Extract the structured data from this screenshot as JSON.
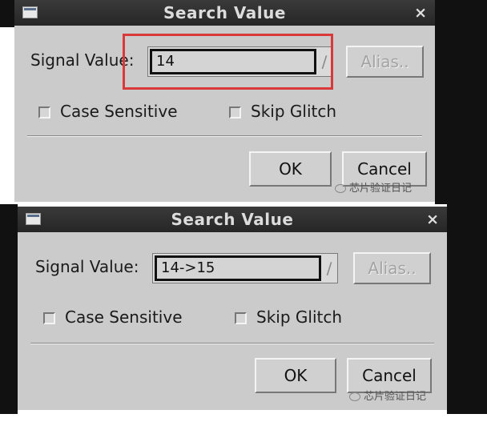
{
  "dialogs": [
    {
      "title": "Search Value",
      "close_glyph": "×",
      "signal_label": "Signal Value:",
      "signal_value": "14",
      "dropdown_glyph": "∕",
      "alias_label": "Alias..",
      "case_sensitive_label": "Case Sensitive",
      "case_sensitive_checked": false,
      "skip_glitch_label": "Skip Glitch",
      "skip_glitch_checked": false,
      "ok_label": "OK",
      "cancel_label": "Cancel",
      "watermark": "芯片验证日记",
      "highlighted": true
    },
    {
      "title": "Search Value",
      "close_glyph": "×",
      "signal_label": "Signal Value:",
      "signal_value": "14->15",
      "dropdown_glyph": "∕",
      "alias_label": "Alias..",
      "case_sensitive_label": "Case Sensitive",
      "case_sensitive_checked": false,
      "skip_glitch_label": "Skip Glitch",
      "skip_glitch_checked": false,
      "ok_label": "OK",
      "cancel_label": "Cancel",
      "watermark": "芯片验证日记",
      "highlighted": false
    }
  ],
  "colors": {
    "highlight": "#d93939",
    "titlebar": "#2e2e2e",
    "dialog_bg": "#cbcbcb"
  }
}
